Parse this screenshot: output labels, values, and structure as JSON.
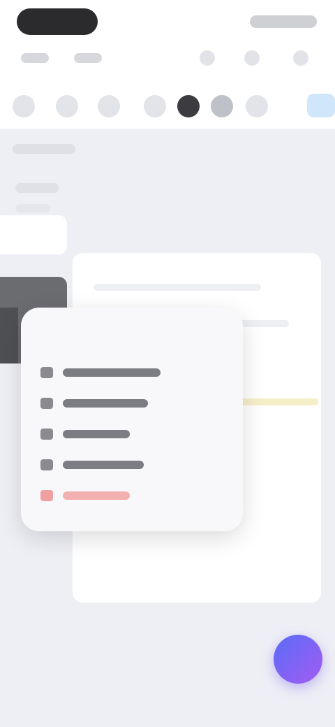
{
  "status_bar": {
    "left_pill": "",
    "right_indicators": ""
  },
  "header": {
    "title": ""
  },
  "toolbar": {
    "tools": [
      "pen-icon",
      "eraser-icon",
      "lasso-icon",
      "ruler-icon",
      "color-dark",
      "color-mid",
      "undo-icon",
      "sync-icon"
    ]
  },
  "context_menu": {
    "items": [
      {
        "label": "",
        "icon": "copy-icon"
      },
      {
        "label": "",
        "icon": "duplicate-icon"
      },
      {
        "label": "",
        "icon": "move-icon"
      },
      {
        "label": "",
        "icon": "rename-icon"
      },
      {
        "label": "",
        "icon": "delete-icon",
        "danger": true
      }
    ]
  },
  "colors": {
    "background": "#eeeff5",
    "danger": "#e24a4a",
    "fab_gradient_start": "#5a6cf7",
    "fab_gradient_end": "#a35cf3",
    "accent": "#cfe6fb"
  }
}
